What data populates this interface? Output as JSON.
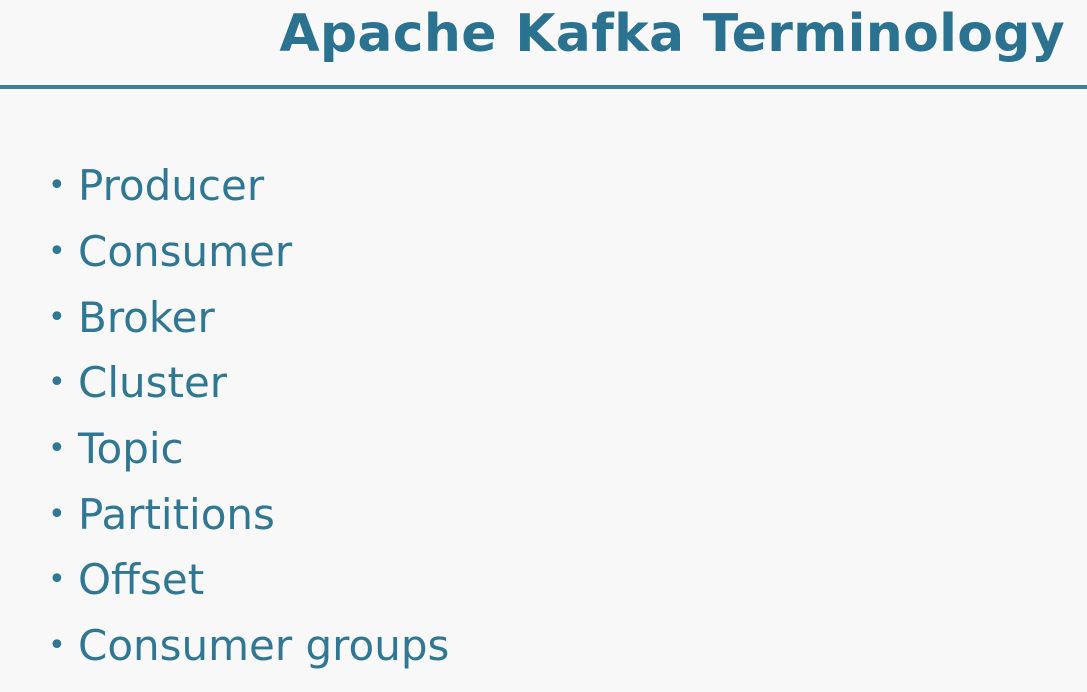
{
  "slide": {
    "title": "Apache Kafka Terminology",
    "bullet_glyph": "•",
    "bullets": [
      "Producer",
      "Consumer",
      "Broker",
      "Cluster",
      "Topic",
      "Partitions",
      "Offset",
      "Consumer groups"
    ]
  },
  "colors": {
    "title": "#2a7290",
    "rule": "#3c7f9b",
    "text": "#2f7792",
    "background": "#f8f8f8"
  }
}
